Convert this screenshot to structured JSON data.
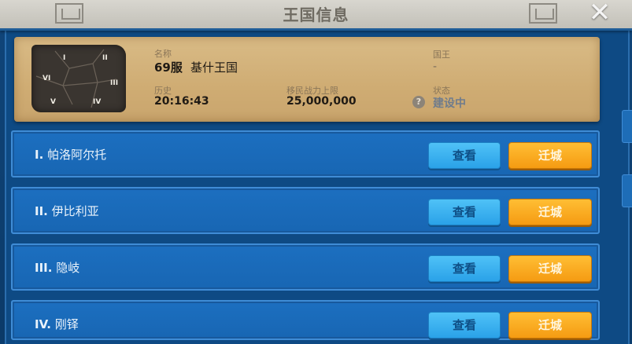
{
  "window": {
    "title": "王国信息",
    "close_label": "✕"
  },
  "kingdom": {
    "map_regions": [
      "I",
      "II",
      "III",
      "IV",
      "V",
      "VI"
    ],
    "name_label": "名称",
    "name_value_prefix": "69服",
    "name_value_suffix": "基什王国",
    "history_label": "历史",
    "history_value": "20:16:43",
    "migration_label": "移民战力上限",
    "migration_value": "25,000,000",
    "king_label": "国王",
    "king_value": "-",
    "status_label": "状态",
    "status_icon": "?",
    "status_value": "建设中"
  },
  "regions": [
    {
      "numeral": "I.",
      "name": "帕洛阿尔托",
      "view_label": "查看",
      "move_label": "迁城"
    },
    {
      "numeral": "II.",
      "name": "伊比利亚",
      "view_label": "查看",
      "move_label": "迁城"
    },
    {
      "numeral": "III.",
      "name": "隐岐",
      "view_label": "查看",
      "move_label": "迁城"
    },
    {
      "numeral": "IV.",
      "name": "刚铎",
      "view_label": "查看",
      "move_label": "迁城"
    }
  ],
  "colors": {
    "view_button": "#2aa2e8",
    "move_button": "#f59b12",
    "row_background": "#1c6fc0",
    "parchment": "#d9bb86"
  }
}
